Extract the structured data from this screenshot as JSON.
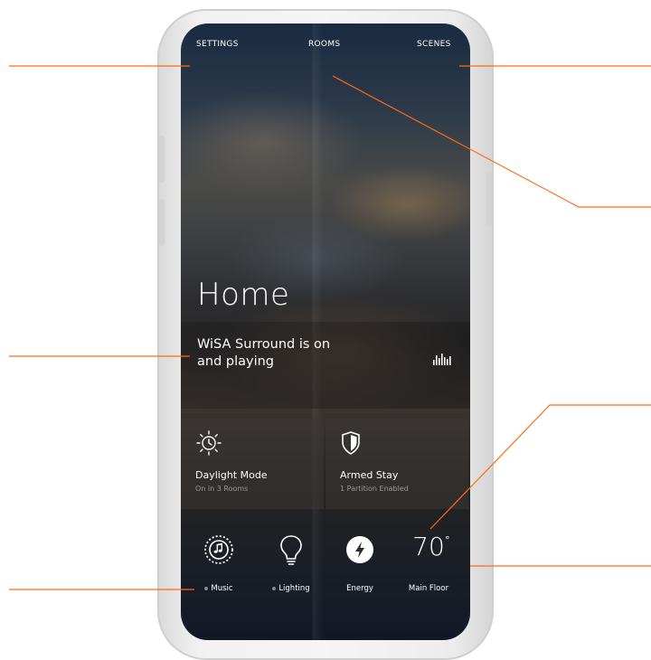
{
  "nav": {
    "settings_label": "SETTINGS",
    "rooms_label": "ROOMS",
    "scenes_label": "SCENES"
  },
  "home": {
    "title": "Home",
    "status_line1": "WiSA Surround is on",
    "status_line2": "and playing"
  },
  "tiles": [
    {
      "title": "Daylight Mode",
      "subtitle": "On in 3 Rooms",
      "icon": "sun-clock-icon"
    },
    {
      "title": "Armed Stay",
      "subtitle": "1 Partition Enabled",
      "icon": "shield-icon"
    }
  ],
  "bottom": {
    "music_label": "Music",
    "lighting_label": "Lighting",
    "energy_label": "Energy",
    "temperature_value": "70",
    "temperature_unit": "°",
    "temperature_label": "Main Floor"
  },
  "colors": {
    "callout_line": "#ff6a13",
    "phone_frame": "#eeeeee"
  }
}
